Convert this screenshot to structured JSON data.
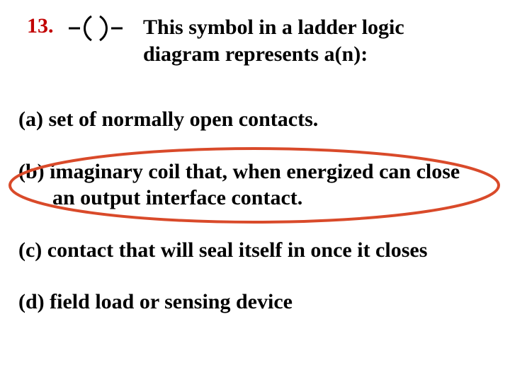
{
  "question": {
    "number": "13.",
    "stem": "This symbol in a ladder logic diagram represents a(n):"
  },
  "options": {
    "a": "(a) set  of normally open contacts.",
    "b_line1": "(b) imaginary coil that, when energized can close",
    "b_line2": "an output interface contact.",
    "c": "(c) contact that will seal itself in once it closes",
    "d": "(d) field load or sensing device"
  },
  "highlight_color": "#d94a2a"
}
